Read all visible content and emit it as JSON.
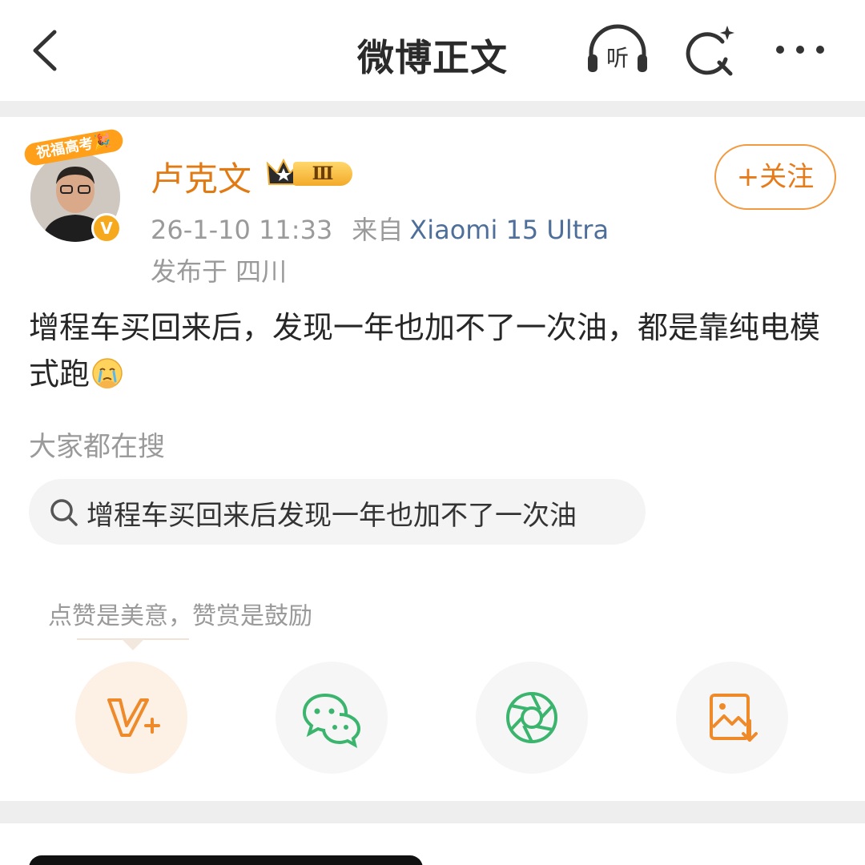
{
  "header": {
    "title": "微博正文",
    "listen_label": "听"
  },
  "author": {
    "name": "卢克文",
    "avatar_banner": "祝福高考🎉",
    "verified_mark": "V",
    "vip_level": "Ⅲ",
    "follow_label": "+关注"
  },
  "post": {
    "time": "26-1-10 11:33",
    "source_label": "来自",
    "device": "Xiaomi 15 Ultra",
    "location": "发布于 四川",
    "text": "增程车买回来后，发现一年也加不了一次油，都是靠纯电模式跑"
  },
  "hot_search": {
    "label": "大家都在搜",
    "query": "增程车买回来后发现一年也加不了一次油"
  },
  "reward": {
    "tip": "点赞是美意，赞赏是鼓励"
  },
  "colors": {
    "accent_orange": "#e27a14",
    "link_blue": "#4f6f9b",
    "wechat_green": "#3bb46e"
  }
}
